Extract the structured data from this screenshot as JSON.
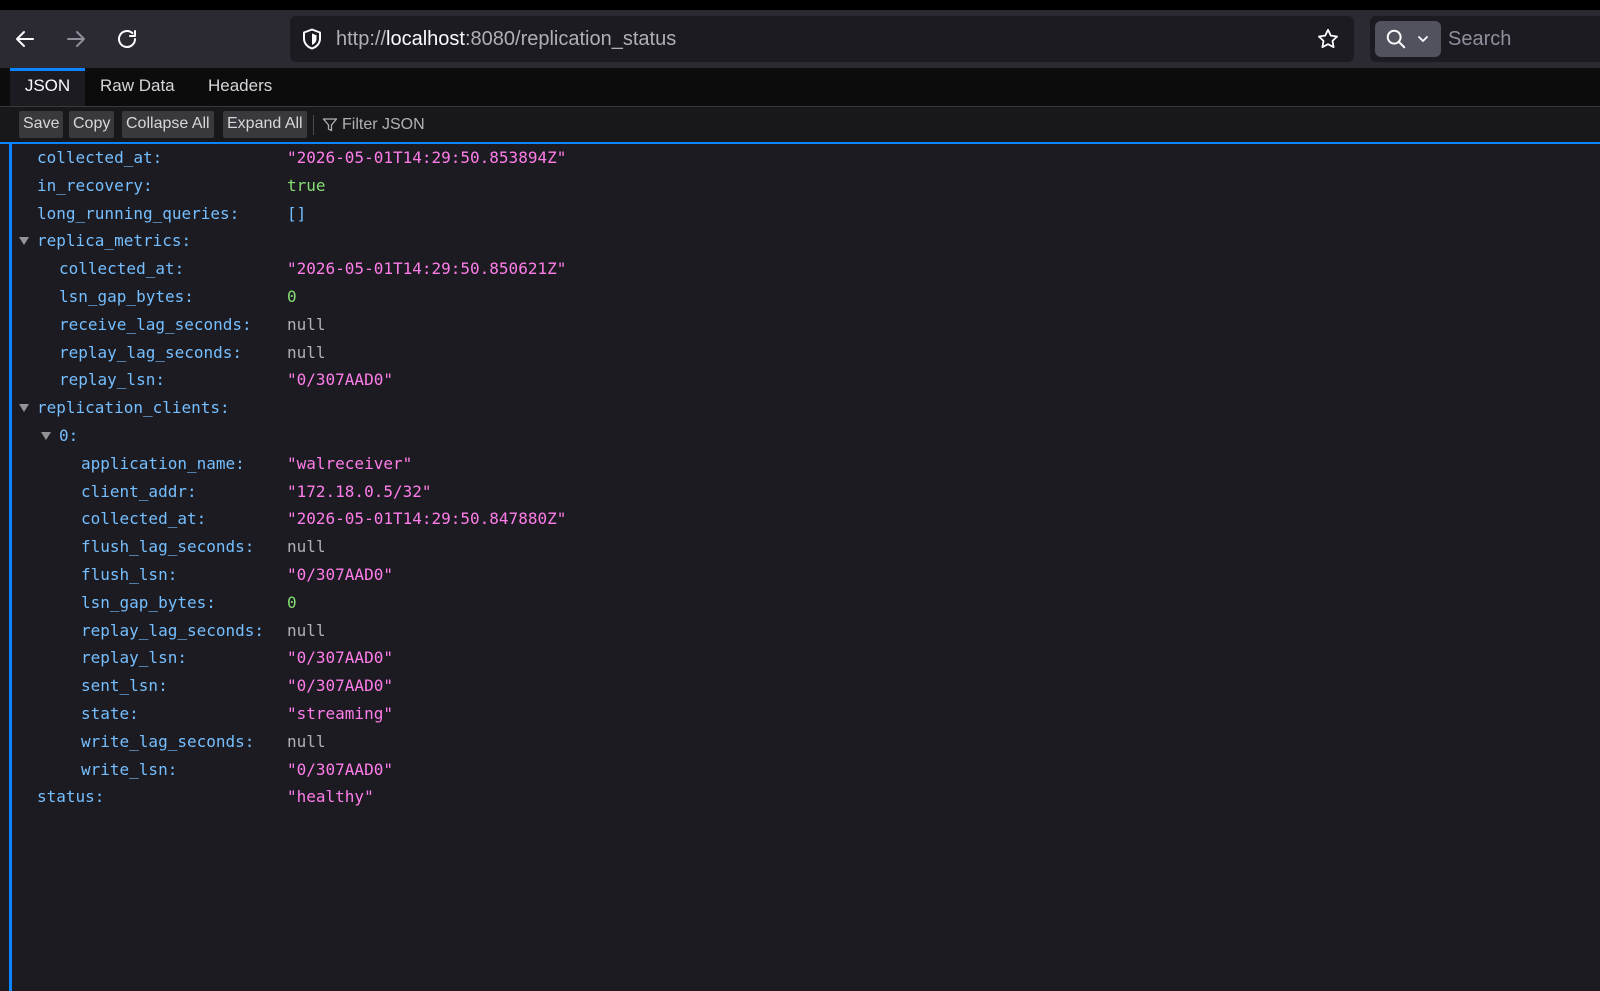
{
  "browser": {
    "url_prefix": "http://",
    "url_host": "localhost",
    "url_rest": ":8080/replication_status",
    "search_placeholder": "Search"
  },
  "viewer": {
    "tabs": [
      {
        "label": "JSON",
        "active": true
      },
      {
        "label": "Raw Data",
        "active": false
      },
      {
        "label": "Headers",
        "active": false
      }
    ],
    "toolbar": {
      "save": "Save",
      "copy": "Copy",
      "collapse_all": "Collapse All",
      "expand_all": "Expand All",
      "filter_placeholder": "Filter JSON"
    }
  },
  "colors": {
    "accent": "#0a84ff",
    "key": "#75bfff",
    "string": "#ff7de9",
    "number_bool": "#86de74",
    "null": "#b1b1b3"
  },
  "tree": [
    {
      "key": "collected_at:",
      "value": "\"2026-05-01T14:29:50.853894Z\"",
      "type": "string",
      "depth": 0
    },
    {
      "key": "in_recovery:",
      "value": "true",
      "type": "bool",
      "depth": 0
    },
    {
      "key": "long_running_queries:",
      "value": "[]",
      "type": "arr",
      "depth": 0
    },
    {
      "key": "replica_metrics:",
      "value": "",
      "type": "object",
      "depth": 0,
      "expanded": true
    },
    {
      "key": "collected_at:",
      "value": "\"2026-05-01T14:29:50.850621Z\"",
      "type": "string",
      "depth": 1
    },
    {
      "key": "lsn_gap_bytes:",
      "value": "0",
      "type": "num",
      "depth": 1
    },
    {
      "key": "receive_lag_seconds:",
      "value": "null",
      "type": "null",
      "depth": 1
    },
    {
      "key": "replay_lag_seconds:",
      "value": "null",
      "type": "null",
      "depth": 1
    },
    {
      "key": "replay_lsn:",
      "value": "\"0/307AAD0\"",
      "type": "string",
      "depth": 1
    },
    {
      "key": "replication_clients:",
      "value": "",
      "type": "object",
      "depth": 0,
      "expanded": true
    },
    {
      "key": "0:",
      "value": "",
      "type": "object",
      "depth": 1,
      "expanded": true
    },
    {
      "key": "application_name:",
      "value": "\"walreceiver\"",
      "type": "string",
      "depth": 2
    },
    {
      "key": "client_addr:",
      "value": "\"172.18.0.5/32\"",
      "type": "string",
      "depth": 2
    },
    {
      "key": "collected_at:",
      "value": "\"2026-05-01T14:29:50.847880Z\"",
      "type": "string",
      "depth": 2
    },
    {
      "key": "flush_lag_seconds:",
      "value": "null",
      "type": "null",
      "depth": 2
    },
    {
      "key": "flush_lsn:",
      "value": "\"0/307AAD0\"",
      "type": "string",
      "depth": 2
    },
    {
      "key": "lsn_gap_bytes:",
      "value": "0",
      "type": "num",
      "depth": 2
    },
    {
      "key": "replay_lag_seconds:",
      "value": "null",
      "type": "null",
      "depth": 2
    },
    {
      "key": "replay_lsn:",
      "value": "\"0/307AAD0\"",
      "type": "string",
      "depth": 2
    },
    {
      "key": "sent_lsn:",
      "value": "\"0/307AAD0\"",
      "type": "string",
      "depth": 2
    },
    {
      "key": "state:",
      "value": "\"streaming\"",
      "type": "string",
      "depth": 2
    },
    {
      "key": "write_lag_seconds:",
      "value": "null",
      "type": "null",
      "depth": 2
    },
    {
      "key": "write_lsn:",
      "value": "\"0/307AAD0\"",
      "type": "string",
      "depth": 2
    },
    {
      "key": "status:",
      "value": "\"healthy\"",
      "type": "string",
      "depth": 0
    }
  ]
}
